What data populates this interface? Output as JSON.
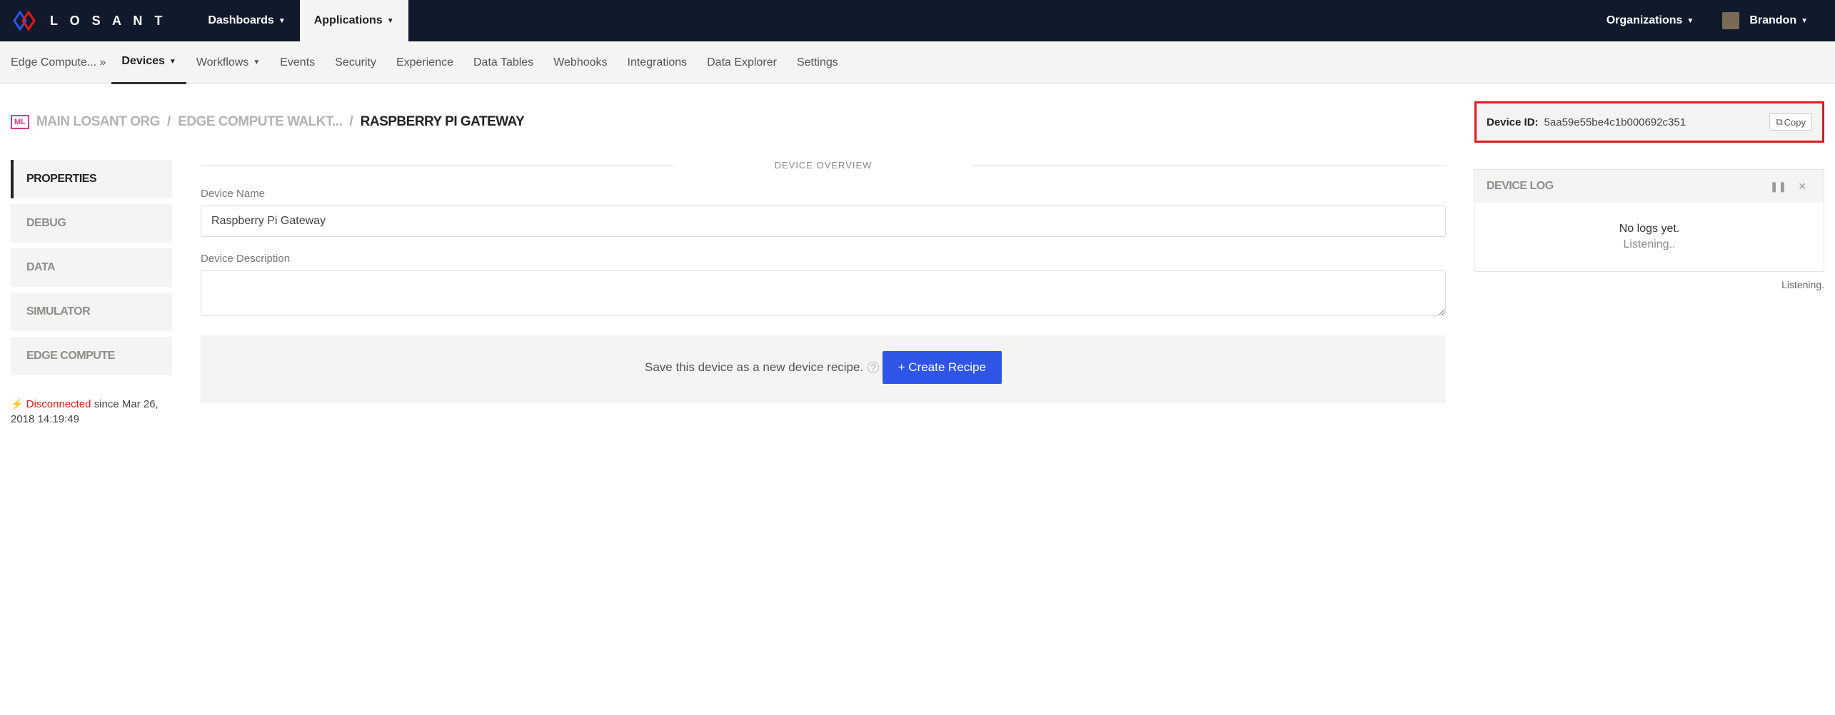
{
  "topnav": {
    "brand": "L O S A N T",
    "dashboards": "Dashboards",
    "applications": "Applications",
    "organizations": "Organizations",
    "user": "Brandon"
  },
  "subnav": {
    "breadcrumb": "Edge Compute... »",
    "devices": "Devices",
    "workflows": "Workflows",
    "events": "Events",
    "security": "Security",
    "experience": "Experience",
    "datatables": "Data Tables",
    "webhooks": "Webhooks",
    "integrations": "Integrations",
    "dataexplorer": "Data Explorer",
    "settings": "Settings"
  },
  "breadcrumb": {
    "badge": "ML",
    "org": "MAIN LOSANT ORG",
    "app": "EDGE COMPUTE WALKT...",
    "device": "RASPBERRY PI GATEWAY"
  },
  "deviceId": {
    "label": "Device ID:",
    "value": "5aa59e55be4c1b000692c351",
    "copy": "Copy"
  },
  "sidetabs": {
    "properties": "PROPERTIES",
    "debug": "DEBUG",
    "data": "DATA",
    "simulator": "SIMULATOR",
    "edgecompute": "EDGE COMPUTE"
  },
  "status": {
    "state": "Disconnected",
    "since": "since Mar 26, 2018 14:19:49"
  },
  "overview": {
    "title": "DEVICE OVERVIEW",
    "name_label": "Device Name",
    "name_value": "Raspberry Pi Gateway",
    "desc_label": "Device Description",
    "desc_value": ""
  },
  "recipe": {
    "text": "Save this device as a new device recipe.",
    "button": "+  Create Recipe"
  },
  "log": {
    "title": "DEVICE LOG",
    "nologs": "No logs yet.",
    "listening": "Listening..",
    "footer": "Listening."
  }
}
